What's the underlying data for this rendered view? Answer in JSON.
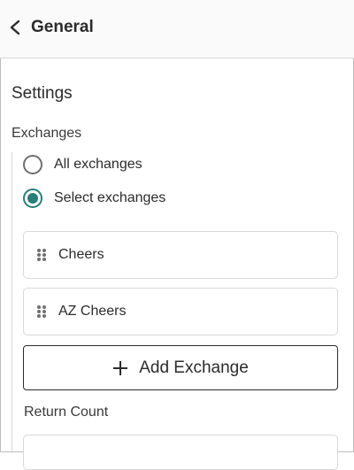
{
  "header": {
    "back_icon": "chevron-left-icon",
    "title": "General"
  },
  "settings": {
    "title": "Settings",
    "exchanges_label": "Exchanges",
    "radio_options": [
      {
        "label": "All exchanges",
        "checked": false
      },
      {
        "label": "Select exchanges",
        "checked": true
      }
    ],
    "exchanges": [
      {
        "name": "Cheers",
        "icon": "drag-handle-icon"
      },
      {
        "name": "AZ Cheers",
        "icon": "drag-handle-icon"
      }
    ],
    "add_button": {
      "label": "Add Exchange",
      "icon": "plus-icon"
    },
    "return_count_label": "Return Count",
    "return_count_value": ""
  },
  "colors": {
    "accent": "#2a7d78",
    "text": "#2b2b2b",
    "border": "#d9d9d9"
  }
}
